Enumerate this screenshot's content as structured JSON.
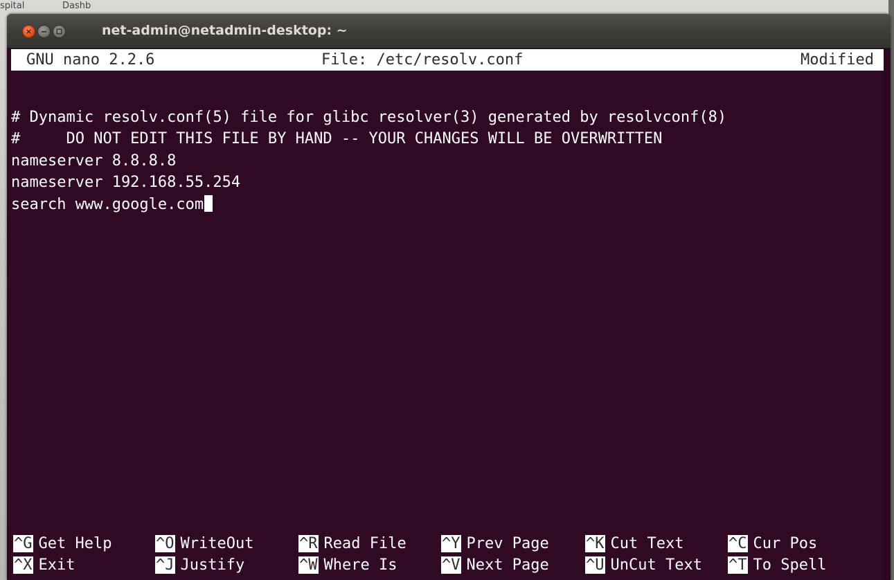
{
  "background": {
    "tab1": "spital",
    "tab2": "Dashb"
  },
  "window": {
    "title": "net-admin@netadmin-desktop: ~",
    "close_symbol": "×",
    "colors": {
      "terminal_bg": "#300a24",
      "titlebar": "#3d3c38",
      "close_button": "#e8531e"
    }
  },
  "nano": {
    "version": "GNU nano 2.2.6",
    "file_label": "File: /etc/resolv.conf",
    "status": "Modified"
  },
  "editor": {
    "lines": [
      "# Dynamic resolv.conf(5) file for glibc resolver(3) generated by resolvconf(8)",
      "#     DO NOT EDIT THIS FILE BY HAND -- YOUR CHANGES WILL BE OVERWRITTEN",
      "nameserver 8.8.8.8",
      "nameserver 192.168.55.254",
      "search www.google.com"
    ]
  },
  "shortcuts": {
    "row1": [
      {
        "key": "^G",
        "label": "Get Help"
      },
      {
        "key": "^O",
        "label": "WriteOut"
      },
      {
        "key": "^R",
        "label": "Read File"
      },
      {
        "key": "^Y",
        "label": "Prev Page"
      },
      {
        "key": "^K",
        "label": "Cut Text"
      },
      {
        "key": "^C",
        "label": "Cur Pos"
      }
    ],
    "row2": [
      {
        "key": "^X",
        "label": "Exit"
      },
      {
        "key": "^J",
        "label": "Justify"
      },
      {
        "key": "^W",
        "label": "Where Is"
      },
      {
        "key": "^V",
        "label": "Next Page"
      },
      {
        "key": "^U",
        "label": "UnCut Text"
      },
      {
        "key": "^T",
        "label": "To Spell"
      }
    ]
  }
}
